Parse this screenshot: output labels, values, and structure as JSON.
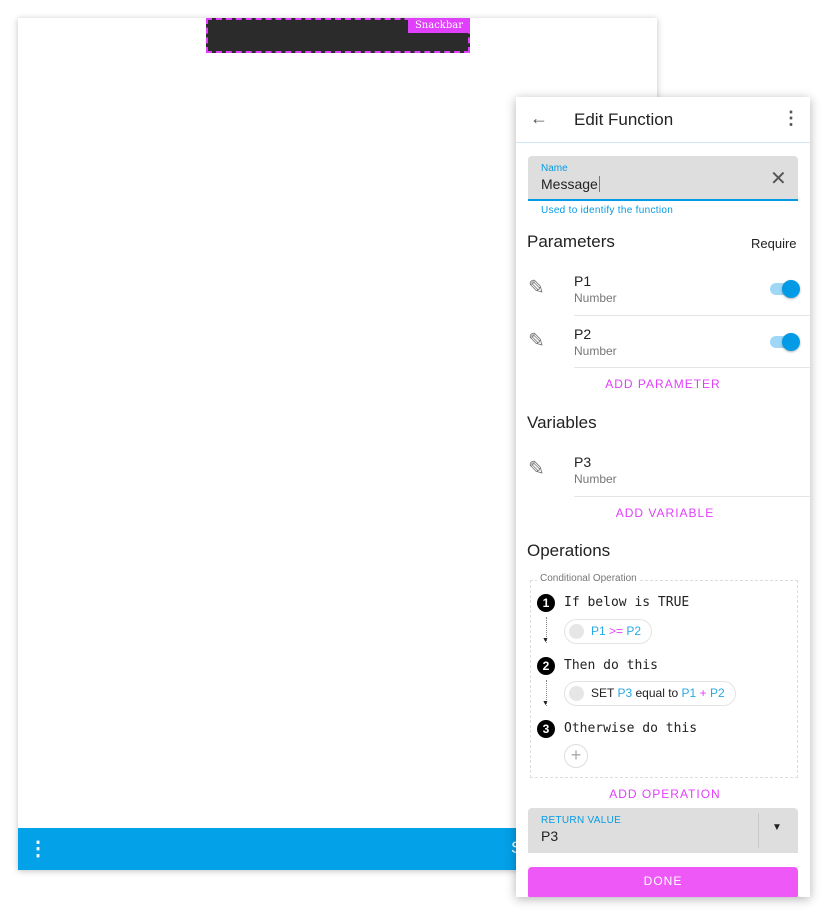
{
  "snackbar": {
    "tag": "Snackbar"
  },
  "bottom_bar": {
    "menu_icon": "more-vert-icon",
    "partial_text": "S"
  },
  "panel": {
    "title": "Edit Function",
    "name_field": {
      "label": "Name",
      "value": "Message",
      "helper": "Used to identify the function"
    },
    "parameters": {
      "heading": "Parameters",
      "require_label": "Require",
      "items": [
        {
          "name": "P1",
          "type": "Number",
          "required": true
        },
        {
          "name": "P2",
          "type": "Number",
          "required": true
        }
      ],
      "add_label": "ADD PARAMETER"
    },
    "variables": {
      "heading": "Variables",
      "items": [
        {
          "name": "P3",
          "type": "Number"
        }
      ],
      "add_label": "ADD VARIABLE"
    },
    "operations": {
      "heading": "Operations",
      "group_label": "Conditional Operation",
      "steps": [
        {
          "num": "1",
          "label": "If below is TRUE",
          "chip": {
            "a": "P1",
            "op": ">=",
            "b": "P2"
          }
        },
        {
          "num": "2",
          "label": "Then do this",
          "chip": {
            "set": "SET",
            "target": "P3",
            "eq": "equal to",
            "a": "P1",
            "op": "+",
            "b": "P2"
          }
        },
        {
          "num": "3",
          "label": "Otherwise do this"
        }
      ],
      "add_label": "ADD OPERATION"
    },
    "return_value": {
      "label": "RETURN VALUE",
      "value": "P3"
    },
    "done_label": "DONE"
  },
  "colors": {
    "accent": "#e040fb",
    "primary": "#039be5",
    "bar": "#03a1e8"
  }
}
